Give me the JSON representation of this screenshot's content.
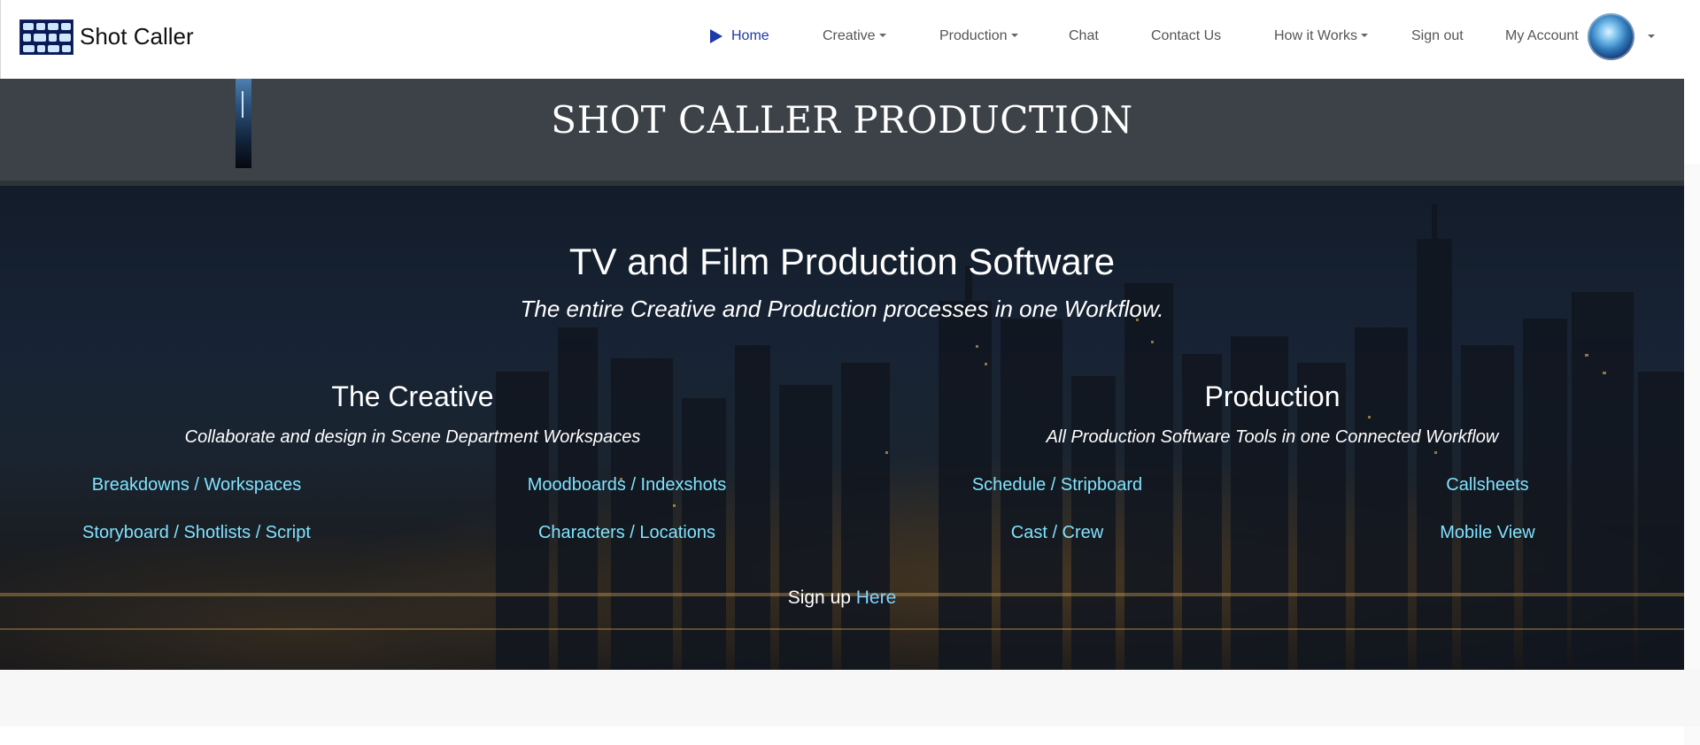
{
  "brand": {
    "name": "Shot Caller",
    "logo_icon": "film-grid-logo"
  },
  "nav": {
    "home": "Home",
    "creative": "Creative",
    "production": "Production",
    "chat": "Chat",
    "contact": "Contact Us",
    "how": "How it Works",
    "signout": "Sign out",
    "account": "My Account"
  },
  "title_band": {
    "title": "SHOT CALLER PRODUCTION"
  },
  "hero": {
    "title": "TV and Film Production Software",
    "subtitle": "The entire Creative and Production processes in one Workflow.",
    "creative": {
      "title": "The Creative",
      "subtitle": "Collaborate and design in Scene Department Workspaces",
      "links": [
        "Breakdowns / Workspaces",
        "Moodboards / Indexshots",
        "Storyboard / Shotlists / Script",
        "Characters / Locations"
      ]
    },
    "production": {
      "title": "Production",
      "subtitle": "All Production Software Tools in one Connected Workflow",
      "links": [
        "Schedule / Stripboard",
        "Callsheets",
        "Cast / Crew",
        "Mobile View"
      ]
    },
    "signup_prefix": "Sign up ",
    "signup_link": "Here"
  },
  "colors": {
    "link": "#7fe3ff",
    "active_nav": "#1e3aa8",
    "title_band_bg": "#3c4247"
  }
}
